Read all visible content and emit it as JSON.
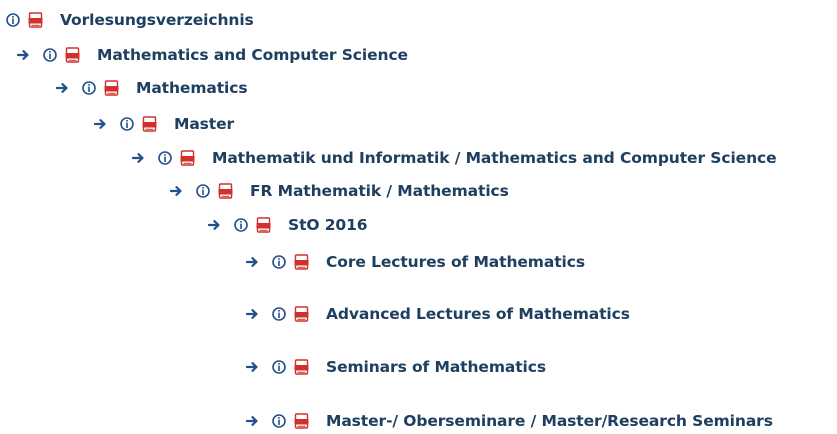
{
  "tree": {
    "items": [
      {
        "label": "Vorlesungsverzeichnis",
        "level": 0,
        "has_arrow": false
      },
      {
        "label": "Mathematics and Computer Science",
        "level": 1,
        "has_arrow": true
      },
      {
        "label": "Mathematics",
        "level": 2,
        "has_arrow": true
      },
      {
        "label": "Master",
        "level": 3,
        "has_arrow": true
      },
      {
        "label": "Mathematik und Informatik / Mathematics and Computer Science",
        "level": 4,
        "has_arrow": true
      },
      {
        "label": "FR Mathematik / Mathematics",
        "level": 5,
        "has_arrow": true
      },
      {
        "label": "StO 2016",
        "level": 6,
        "has_arrow": true
      },
      {
        "label": "Core Lectures of Mathematics",
        "level": 7,
        "has_arrow": true
      },
      {
        "label": "Advanced Lectures of Mathematics",
        "level": 7,
        "has_arrow": true
      },
      {
        "label": "Seminars of Mathematics",
        "level": 7,
        "has_arrow": true
      },
      {
        "label": "Master-/ Oberseminare / Master/Research Seminars",
        "level": 7,
        "has_arrow": true
      }
    ]
  },
  "icons": {
    "arrow": "right-arrow-icon",
    "info": "info-icon",
    "pdf": "pdf-icon"
  },
  "colors": {
    "link_text": "#1f3f60",
    "icon_blue": "#24508a",
    "pdf_red": "#d0312d"
  }
}
